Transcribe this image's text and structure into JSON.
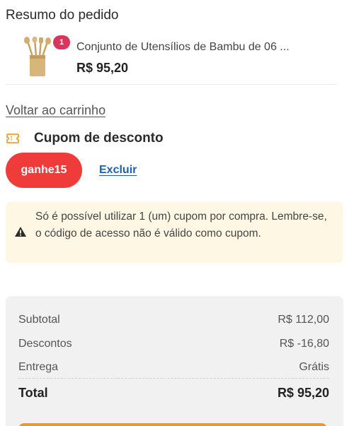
{
  "order_summary": {
    "title": "Resumo do pedido",
    "product": {
      "name": "Conjunto de Utensílios de Bambu de 06 ...",
      "price": "R$ 95,20",
      "quantity": "1"
    }
  },
  "back_link": "Voltar ao carrinho",
  "coupon": {
    "title": "Cupom de desconto",
    "code": "ganhe15",
    "remove_label": "Excluir",
    "icon": "ticket-icon"
  },
  "notice": {
    "text": "Só é possível utilizar 1 (um) cupom por compra. Lembre-se, o código de acesso não é válido como cupom.",
    "icon": "warning-icon"
  },
  "totals": {
    "subtotal_label": "Subtotal",
    "subtotal_value": "R$ 112,00",
    "discount_label": "Descontos",
    "discount_value": "R$ -16,80",
    "shipping_label": "Entrega",
    "shipping_value": "Grátis",
    "total_label": "Total",
    "total_value": "R$ 95,20"
  },
  "colors": {
    "coupon_chip": "#f03b3b",
    "badge": "#d9365e",
    "link": "#1f5fae",
    "notice_bg": "#fdf7e4",
    "checkout_button": "#f09a1c"
  }
}
